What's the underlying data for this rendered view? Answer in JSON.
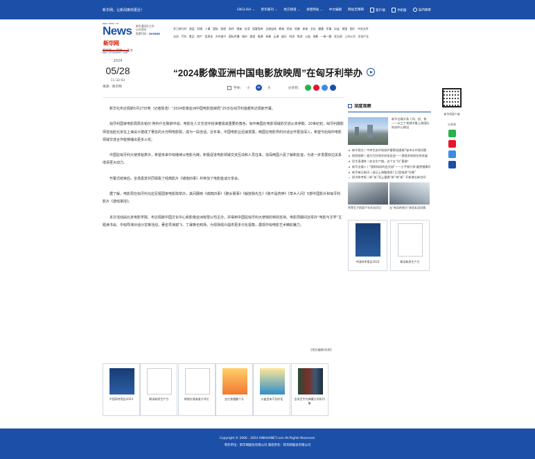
{
  "topbar": {
    "slogan": "新华网，让新闻离你更近！",
    "links": [
      "ENGLISH ⌄",
      "新华报刊 ⌄",
      "地方频道 ⌄",
      "承建网站 ⌄",
      "中文编辑",
      "网站无障碍"
    ],
    "client_app": "客户端",
    "mobile": "手机版",
    "search": "站内搜索"
  },
  "header": {
    "logo_url": "www.news.cn",
    "logo_brand": "News",
    "logo_cn": "新华网",
    "logo_sub": "www.xinhuanet.com",
    "corp_lines": [
      "新华通讯社主办",
      "公司官网"
    ],
    "stock_label": "股票代码：",
    "stock_code": "603888",
    "nav_row1": [
      "学习进行时",
      "高层",
      "时政",
      "人事",
      "国际",
      "财经",
      "网评",
      "港澳",
      "台湾",
      "思客智库",
      "全球连线",
      "教育",
      "科技",
      "科普",
      "体育",
      "文化",
      "健康",
      "军事",
      "访谈",
      "视频",
      "图片",
      "中关文件"
    ],
    "nav_row2": [
      "法治",
      "汽车",
      "食品",
      "房产",
      "信息化",
      "乡村振兴",
      "国际传播",
      "城市",
      "旅游",
      "能源",
      "亲事",
      "云课",
      "娱乐",
      "时尚",
      "悦读",
      "公益",
      "电影",
      "一带一路",
      "亚太网",
      "上市公司",
      "文化产业"
    ]
  },
  "breadcrumb": "新华网 > 新闻 > 正文",
  "article": {
    "year": "2024",
    "month_day": "05/28",
    "time": "11:32:03",
    "source": "来源：新华网",
    "title": "“2024影像亚洲中国电影放映周”在匈牙利举办",
    "font_label": "字体：",
    "font_small": "小",
    "font_medium": "中",
    "font_large": "大",
    "share_label": "分享到：",
    "paragraphs": [
      "新华社布达佩斯5月27日电（记者陈浩）“2024影像亚洲中国电影放映周”25日在匈牙利首都布达佩斯开幕。",
      "匈牙利国家电影局局长帕尔·阿科什在致辞中说，电影在人文交流中扮演着极其重要的角色，匈中两国在电影领域的交流从未停歇。20世纪初，匈牙利摄影师曾远赴北京在上海设计建成了著名的大光明电影院，成为一段佳话。近年来，中国电影业迅速发展，两国在电影界的对话合作更加深入，希望今后匈中电影领域交流合作能够播出更多火花。",
      "中国驻匈牙利大使龚韬表示，希望未来中匈继续以电影为媒，积极促进电影领域交流互动和人员往来，加深两国人民了解和友谊，为进一步发展双边关系增添更大动力。",
      "开幕式结束后，全场嘉宾共同观看了经典影片《城南旧事》并参加了电影座谈分享会。",
      "据了解，电影周在匈牙利乌拉尼娅国家电影院举办，其间展映《城南旧事》《跑女朋事》《解放我先生》《我不是药神》《草木人间》5部中国影片和匈牙利影片《游戏掌控》。",
      "本次活动由北京电影学院、布达佩斯中国文化中心和影像亚洲有限公司主办，并得到中国驻匈牙利大使馆的特别支持。电影周期间还举办“电影与文学”主题读书会、中匈导演对话沙龙等活动，著名导演谢飞、丁晟等也到场，为现场观众提供更多元化视角，展现中匈电影艺术精彩魅力。"
    ],
    "editor": "【责任编辑:陈荣】"
  },
  "side": {
    "heading": "深度观察",
    "feature_caption": "新华全媒头条丨闯、创、育——从三个关键字看上海国际科创中心建设",
    "list": [
      "新华视点丨中央生态环境保护督察组通报7省市水环境问题",
      "财经观察丨政力打好保交房攻坚战——透视多地保交房进展",
      "民生直通车丨安全生产路，这个太“坑”要避！",
      "新华全媒+丨“我帮妈妈的白大褂”——小手推行停·圆梦健康乐",
      "新华每日电讯丨谁记上海鞍炮奇门已是电源“住事”",
      "经济参考报丨新“街”而上量换“新”带“新” 开新增长新空间"
    ],
    "pics": [
      {
        "caption": "师等孔子前面千年文化印记"
      },
      {
        "caption": "去“有风的地方”体验乳齿风情"
      }
    ],
    "books": [
      "中国网考报告2024",
      "解读新质生产力"
    ]
  },
  "rightbar": {
    "qr_label": "新华网客户端",
    "share_label": "分享到"
  },
  "related": [
    {
      "title": "中国网考报告2024",
      "cover": "blue"
    },
    {
      "title": "解读新质生产力",
      "cover": "blank"
    },
    {
      "title": "带钢文境者者方寻亿",
      "cover": "blank"
    },
    {
      "title": "金位我遇翻个天",
      "cover": "orange"
    },
    {
      "title": "沙盒里来不及的话",
      "cover": "yellow"
    },
    {
      "title": "金寿百宇光典藏大间系列集",
      "cover": "dark"
    }
  ],
  "footer": {
    "copyright": "Copyright © 2000 - 2024 XINHUANET.com   All Rights Reserved.",
    "producer": "制作单位：新华网股份有限公司     版权所有：新华网股份有限公司"
  }
}
